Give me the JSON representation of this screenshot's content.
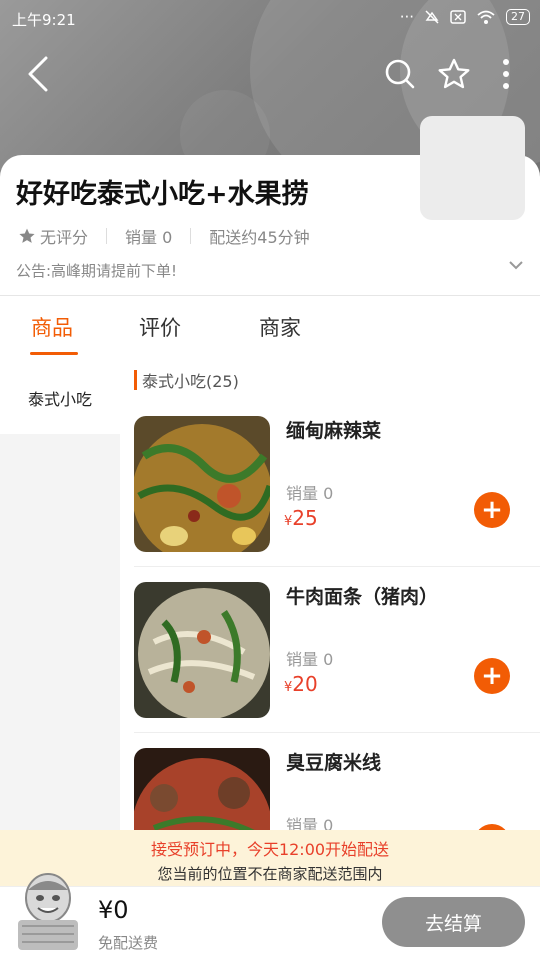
{
  "status_bar": {
    "time": "上午9:21",
    "battery": "27"
  },
  "shop": {
    "name": "好好吃泰式小吃+水果捞",
    "rating": "无评分",
    "sales": "销量 0",
    "delivery": "配送约45分钟",
    "notice": "公告:高峰期请提前下单!"
  },
  "tabs": [
    {
      "label": "商品"
    },
    {
      "label": "评价"
    },
    {
      "label": "商家"
    }
  ],
  "sidebar": {
    "items": [
      {
        "label": "泰式小吃"
      }
    ]
  },
  "category": {
    "title": "泰式小吃(25)"
  },
  "products": [
    {
      "name": "缅甸麻辣菜",
      "sales": "销量 0",
      "currency": "¥",
      "price": "25"
    },
    {
      "name": "牛肉面条（猪肉）",
      "sales": "销量 0",
      "currency": "¥",
      "price": "20"
    },
    {
      "name": "臭豆腐米线",
      "sales": "销量 0",
      "currency": "¥",
      "price": ""
    }
  ],
  "banner": {
    "line1": "接受预订中，今天12:00开始配送",
    "line2": "您当前的位置不在商家配送范围内"
  },
  "cart": {
    "total": "¥0",
    "fee": "免配送费",
    "checkout": "去结算"
  },
  "colors": {
    "accent": "#f25c05",
    "price": "#e8402a",
    "banner_bg": "#fdf3d9",
    "checkout_bg": "#8f8f8f"
  },
  "icons": [
    "back-icon",
    "search-icon",
    "star-icon",
    "more-icon",
    "add-icon",
    "chevron-down-icon",
    "cart-mascot-icon"
  ]
}
